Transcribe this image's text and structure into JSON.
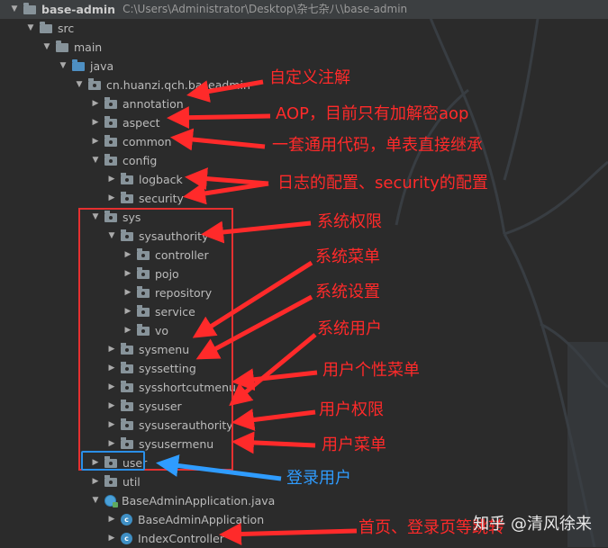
{
  "tree": [
    {
      "label": "base-admin",
      "path": "C:\\Users\\Administrator\\Desktop\\杂七杂八\\base-admin",
      "icon": "folder-icon",
      "expanded": true
    },
    {
      "label": "src",
      "icon": "folder-icon",
      "expanded": true
    },
    {
      "label": "main",
      "icon": "folder-icon",
      "expanded": true
    },
    {
      "label": "java",
      "icon": "folder-icon",
      "expanded": true
    },
    {
      "label": "cn.huanzi.qch.baseadmin",
      "icon": "package-icon",
      "expanded": true
    },
    {
      "label": "annotation",
      "icon": "package-icon",
      "expanded": false
    },
    {
      "label": "aspect",
      "icon": "package-icon",
      "expanded": false
    },
    {
      "label": "common",
      "icon": "package-icon",
      "expanded": false
    },
    {
      "label": "config",
      "icon": "package-icon",
      "expanded": true
    },
    {
      "label": "logback",
      "icon": "package-icon",
      "expanded": false
    },
    {
      "label": "security",
      "icon": "package-icon",
      "expanded": false
    },
    {
      "label": "sys",
      "icon": "package-icon",
      "expanded": true
    },
    {
      "label": "sysauthority",
      "icon": "package-icon",
      "expanded": true
    },
    {
      "label": "controller",
      "icon": "package-icon",
      "expanded": false
    },
    {
      "label": "pojo",
      "icon": "package-icon",
      "expanded": false
    },
    {
      "label": "repository",
      "icon": "package-icon",
      "expanded": false
    },
    {
      "label": "service",
      "icon": "package-icon",
      "expanded": false
    },
    {
      "label": "vo",
      "icon": "package-icon",
      "expanded": false
    },
    {
      "label": "sysmenu",
      "icon": "package-icon",
      "expanded": false
    },
    {
      "label": "syssetting",
      "icon": "package-icon",
      "expanded": false
    },
    {
      "label": "sysshortcutmenu",
      "icon": "package-icon",
      "expanded": false
    },
    {
      "label": "sysuser",
      "icon": "package-icon",
      "expanded": false
    },
    {
      "label": "sysuserauthority",
      "icon": "package-icon",
      "expanded": false
    },
    {
      "label": "sysusermenu",
      "icon": "package-icon",
      "expanded": false
    },
    {
      "label": "user",
      "icon": "package-icon",
      "expanded": false
    },
    {
      "label": "util",
      "icon": "package-icon",
      "expanded": false
    },
    {
      "label": "BaseAdminApplication.java",
      "icon": "java-file-icon",
      "expanded": true
    },
    {
      "label": "BaseAdminApplication",
      "icon": "class-icon",
      "expanded": false
    },
    {
      "label": "IndexController",
      "icon": "class-icon",
      "expanded": false
    }
  ],
  "annotations": {
    "annotation": "自定义注解",
    "aspect": "AOP，目前只有加解密aop",
    "common": "一套通用代码，单表直接继承",
    "config": "日志的配置、security的配置",
    "sysauthority": "系统权限",
    "sysmenu": "系统菜单",
    "syssetting": "系统设置",
    "sysuser": "系统用户",
    "sysshortcutmenu": "用户个性菜单",
    "sysuserauthority": "用户权限",
    "sysusermenu": "用户菜单",
    "user": "登录用户",
    "index": "首页、登录页等跳转"
  },
  "watermark": "知乎 @清风徐来",
  "colors": {
    "annotation": "#ff2a2a",
    "login_annotation": "#2f9cff",
    "background": "#2b2b2b"
  }
}
